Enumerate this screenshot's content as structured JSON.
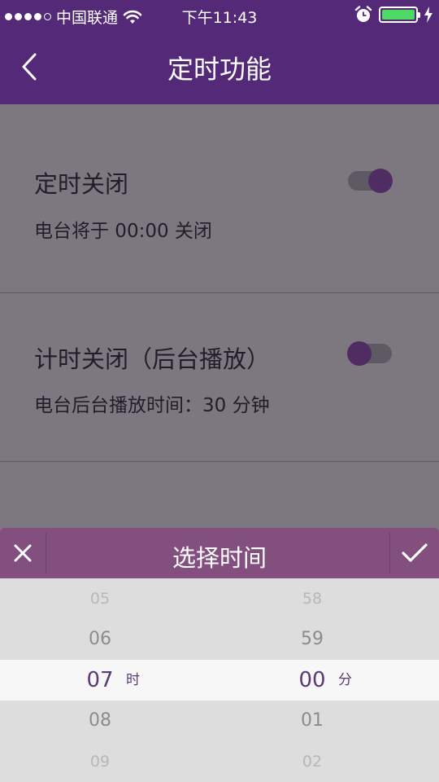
{
  "status_bar": {
    "carrier": "中国联通",
    "time": "下午11:43",
    "battery_level": 1.0,
    "battery_color": "#4cd964"
  },
  "nav": {
    "title": "定时功能",
    "back_icon": "chevron-left-icon"
  },
  "timer_close": {
    "title": "定时关闭",
    "description": "电台将于 00:00 关闭",
    "enabled": true
  },
  "countdown_close": {
    "title": "计时关闭（后台播放）",
    "description": "电台后台播放时间：30 分钟",
    "enabled": false
  },
  "picker": {
    "title": "选择时间",
    "close_icon": "close-icon",
    "confirm_icon": "check-icon",
    "hours": [
      "05",
      "06",
      "07",
      "08",
      "09"
    ],
    "selected_hour": "07",
    "hour_unit": "时",
    "minutes": [
      "58",
      "59",
      "00",
      "01",
      "02"
    ],
    "selected_minute": "00",
    "minute_unit": "分"
  },
  "colors": {
    "header": "#542a78",
    "picker_header": "#834f7f",
    "selected_text": "#5b3a74",
    "overlay": "#7d7880"
  }
}
